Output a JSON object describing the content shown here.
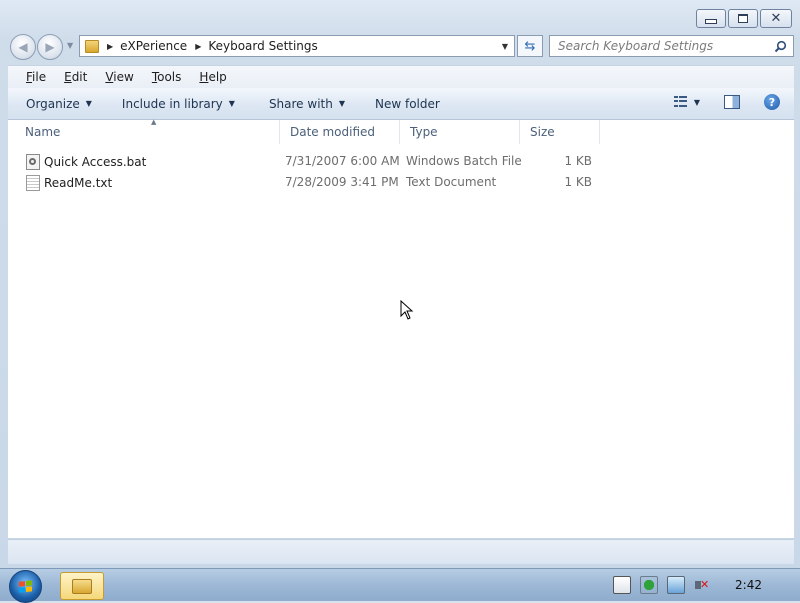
{
  "window": {
    "caption_buttons": {
      "minimize": "minimize",
      "maximize": "maximize",
      "close": "close"
    }
  },
  "address_bar": {
    "breadcrumbs": [
      "eXPerience",
      "Keyboard Settings"
    ]
  },
  "search": {
    "placeholder": "Search Keyboard Settings"
  },
  "menu": {
    "items": [
      "File",
      "Edit",
      "View",
      "Tools",
      "Help"
    ],
    "mnemonics": [
      "F",
      "E",
      "V",
      "T",
      "H"
    ]
  },
  "command_bar": {
    "organize": "Organize",
    "include_in_library": "Include in library",
    "share_with": "Share with",
    "new_folder": "New folder"
  },
  "columns": {
    "name": "Name",
    "date_modified": "Date modified",
    "type": "Type",
    "size": "Size"
  },
  "files": [
    {
      "name": "Quick Access.bat",
      "date": "7/31/2007 6:00 AM",
      "type": "Windows Batch File",
      "size": "1 KB",
      "icon": "batch-file-icon"
    },
    {
      "name": "ReadMe.txt",
      "date": "7/28/2009 3:41 PM",
      "type": "Text Document",
      "size": "1 KB",
      "icon": "text-file-icon"
    }
  ],
  "taskbar": {
    "clock": "2:42"
  },
  "colors": {
    "accent": "#2f6bb3",
    "content_bg": "#ffffff",
    "chrome": "#cfdcea"
  }
}
